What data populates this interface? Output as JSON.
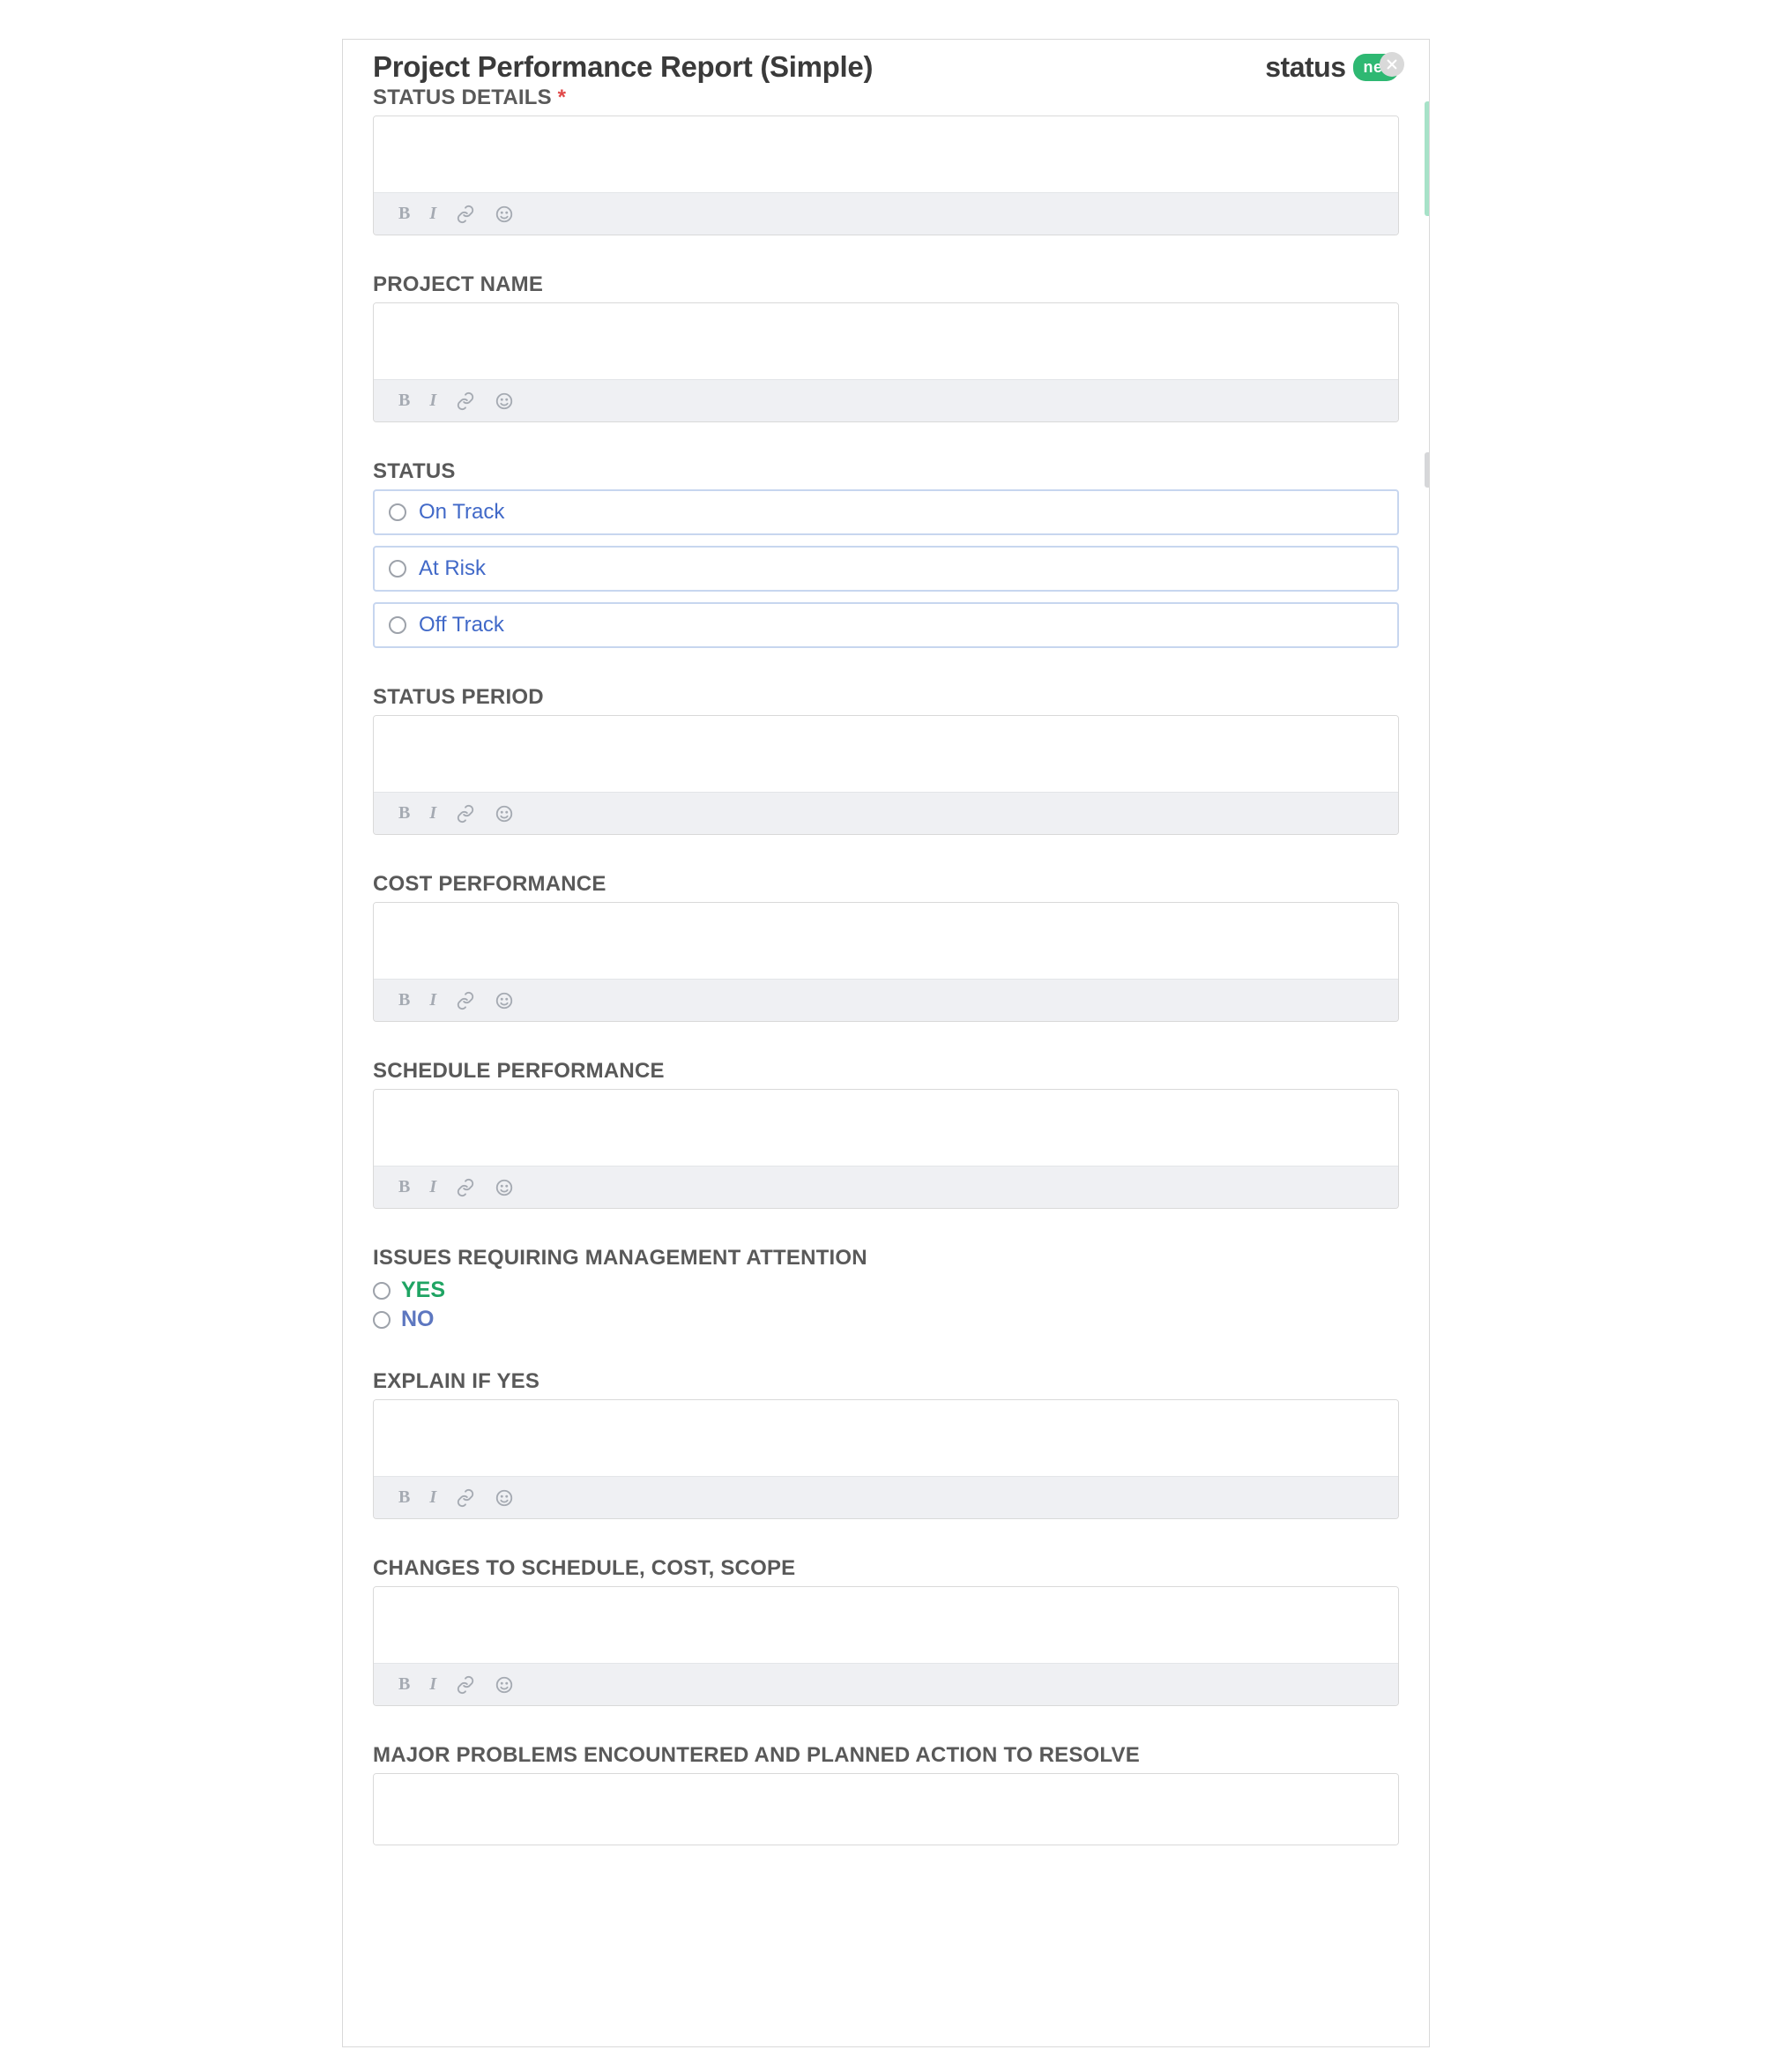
{
  "header": {
    "title": "Project Performance Report (Simple)",
    "brand_text": "status",
    "brand_badge": "net"
  },
  "fields": {
    "status_details": {
      "label": "STATUS DETAILS",
      "required": true
    },
    "project_name": {
      "label": "PROJECT NAME"
    },
    "status": {
      "label": "STATUS",
      "options": [
        "On Track",
        "At Risk",
        "Off Track"
      ]
    },
    "status_period": {
      "label": "STATUS PERIOD"
    },
    "cost_performance": {
      "label": "COST PERFORMANCE"
    },
    "schedule_performance": {
      "label": "SCHEDULE PERFORMANCE"
    },
    "issues_mgmt": {
      "label": "ISSUES REQUIRING MANAGEMENT ATTENTION",
      "yes": "YES",
      "no": "NO"
    },
    "explain_if_yes": {
      "label": "EXPLAIN IF YES"
    },
    "changes": {
      "label": "CHANGES TO SCHEDULE, COST, SCOPE"
    },
    "major_problems": {
      "label": "MAJOR PROBLEMS ENCOUNTERED AND PLANNED ACTION TO RESOLVE"
    }
  },
  "required_mark": "*"
}
